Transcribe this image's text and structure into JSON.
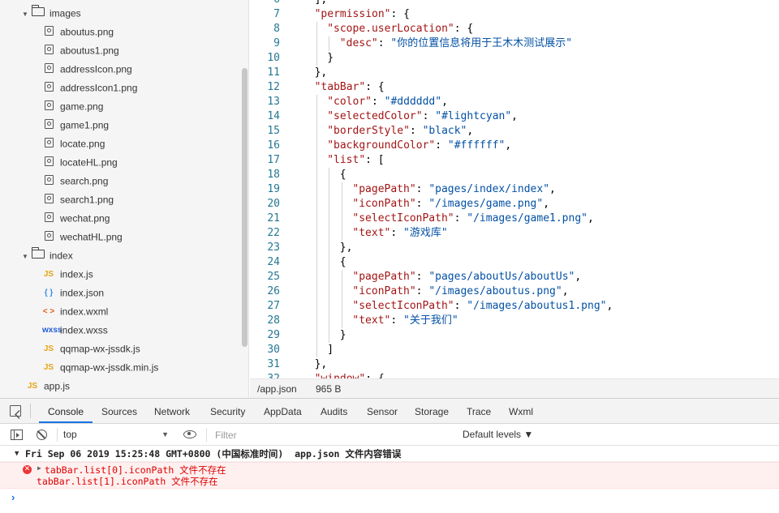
{
  "tree": {
    "rows": [
      {
        "kind": "folder",
        "label": "images",
        "icon": "folder-open-icon",
        "indent": 1
      },
      {
        "kind": "img",
        "label": "aboutus.png",
        "icon": "image-file-icon",
        "indent": 2
      },
      {
        "kind": "img",
        "label": "aboutus1.png",
        "icon": "image-file-icon",
        "indent": 2
      },
      {
        "kind": "img",
        "label": "addressIcon.png",
        "icon": "image-file-icon",
        "indent": 2
      },
      {
        "kind": "img",
        "label": "addressIcon1.png",
        "icon": "image-file-icon",
        "indent": 2
      },
      {
        "kind": "img",
        "label": "game.png",
        "icon": "image-file-icon",
        "indent": 2
      },
      {
        "kind": "img",
        "label": "game1.png",
        "icon": "image-file-icon",
        "indent": 2
      },
      {
        "kind": "img",
        "label": "locate.png",
        "icon": "image-file-icon",
        "indent": 2
      },
      {
        "kind": "img",
        "label": "locateHL.png",
        "icon": "image-file-icon",
        "indent": 2
      },
      {
        "kind": "img",
        "label": "search.png",
        "icon": "image-file-icon",
        "indent": 2
      },
      {
        "kind": "img",
        "label": "search1.png",
        "icon": "image-file-icon",
        "indent": 2
      },
      {
        "kind": "img",
        "label": "wechat.png",
        "icon": "image-file-icon",
        "indent": 2
      },
      {
        "kind": "img",
        "label": "wechatHL.png",
        "icon": "image-file-icon",
        "indent": 2
      },
      {
        "kind": "folder",
        "label": "index",
        "icon": "folder-open-icon",
        "indent": 1
      },
      {
        "kind": "js",
        "label": "index.js",
        "icon": "js-file-icon",
        "badge": "JS",
        "indent": 2
      },
      {
        "kind": "json",
        "label": "index.json",
        "icon": "json-file-icon",
        "badge": "{ }",
        "indent": 2
      },
      {
        "kind": "wxml",
        "label": "index.wxml",
        "icon": "wxml-file-icon",
        "badge": "< >",
        "indent": 2
      },
      {
        "kind": "wxss",
        "label": "index.wxss",
        "icon": "wxss-file-icon",
        "badge": "wxss",
        "indent": 2
      },
      {
        "kind": "js",
        "label": "qqmap-wx-jssdk.js",
        "icon": "js-file-icon",
        "badge": "JS",
        "indent": 2
      },
      {
        "kind": "js",
        "label": "qqmap-wx-jssdk.min.js",
        "icon": "js-file-icon",
        "badge": "JS",
        "indent": 2
      },
      {
        "kind": "js",
        "label": "app.js",
        "icon": "js-file-icon",
        "badge": "JS",
        "indent": 1
      }
    ]
  },
  "editor": {
    "lines": [
      {
        "n": "6",
        "indent": 2,
        "tokens": [
          {
            "t": "p",
            "v": "],"
          }
        ]
      },
      {
        "n": "7",
        "indent": 2,
        "tokens": [
          {
            "t": "k",
            "v": "\"permission\""
          },
          {
            "t": "p",
            "v": ": {"
          }
        ]
      },
      {
        "n": "8",
        "indent": 4,
        "tokens": [
          {
            "t": "k",
            "v": "\"scope.userLocation\""
          },
          {
            "t": "p",
            "v": ": {"
          }
        ]
      },
      {
        "n": "9",
        "indent": 6,
        "tokens": [
          {
            "t": "k",
            "v": "\"desc\""
          },
          {
            "t": "p",
            "v": ": "
          },
          {
            "t": "s",
            "v": "\"你的位置信息将用于王木木测试展示\""
          }
        ]
      },
      {
        "n": "10",
        "indent": 4,
        "tokens": [
          {
            "t": "p",
            "v": "}"
          }
        ]
      },
      {
        "n": "11",
        "indent": 2,
        "tokens": [
          {
            "t": "p",
            "v": "},"
          }
        ]
      },
      {
        "n": "12",
        "indent": 2,
        "tokens": [
          {
            "t": "k",
            "v": "\"tabBar\""
          },
          {
            "t": "p",
            "v": ": {"
          }
        ]
      },
      {
        "n": "13",
        "indent": 4,
        "tokens": [
          {
            "t": "k",
            "v": "\"color\""
          },
          {
            "t": "p",
            "v": ": "
          },
          {
            "t": "s",
            "v": "\"#dddddd\""
          },
          {
            "t": "p",
            "v": ","
          }
        ]
      },
      {
        "n": "14",
        "indent": 4,
        "tokens": [
          {
            "t": "k",
            "v": "\"selectedColor\""
          },
          {
            "t": "p",
            "v": ": "
          },
          {
            "t": "s",
            "v": "\"#lightcyan\""
          },
          {
            "t": "p",
            "v": ","
          }
        ]
      },
      {
        "n": "15",
        "indent": 4,
        "tokens": [
          {
            "t": "k",
            "v": "\"borderStyle\""
          },
          {
            "t": "p",
            "v": ": "
          },
          {
            "t": "s",
            "v": "\"black\""
          },
          {
            "t": "p",
            "v": ","
          }
        ]
      },
      {
        "n": "16",
        "indent": 4,
        "tokens": [
          {
            "t": "k",
            "v": "\"backgroundColor\""
          },
          {
            "t": "p",
            "v": ": "
          },
          {
            "t": "s",
            "v": "\"#ffffff\""
          },
          {
            "t": "p",
            "v": ","
          }
        ]
      },
      {
        "n": "17",
        "indent": 4,
        "tokens": [
          {
            "t": "k",
            "v": "\"list\""
          },
          {
            "t": "p",
            "v": ": ["
          }
        ]
      },
      {
        "n": "18",
        "indent": 6,
        "tokens": [
          {
            "t": "p",
            "v": "{"
          }
        ]
      },
      {
        "n": "19",
        "indent": 8,
        "tokens": [
          {
            "t": "k",
            "v": "\"pagePath\""
          },
          {
            "t": "p",
            "v": ": "
          },
          {
            "t": "s",
            "v": "\"pages/index/index\""
          },
          {
            "t": "p",
            "v": ","
          }
        ]
      },
      {
        "n": "20",
        "indent": 8,
        "tokens": [
          {
            "t": "k",
            "v": "\"iconPath\""
          },
          {
            "t": "p",
            "v": ": "
          },
          {
            "t": "s",
            "v": "\"/images/game.png\""
          },
          {
            "t": "p",
            "v": ","
          }
        ]
      },
      {
        "n": "21",
        "indent": 8,
        "tokens": [
          {
            "t": "k",
            "v": "\"selectIconPath\""
          },
          {
            "t": "p",
            "v": ": "
          },
          {
            "t": "s",
            "v": "\"/images/game1.png\""
          },
          {
            "t": "p",
            "v": ","
          }
        ]
      },
      {
        "n": "22",
        "indent": 8,
        "tokens": [
          {
            "t": "k",
            "v": "\"text\""
          },
          {
            "t": "p",
            "v": ": "
          },
          {
            "t": "s",
            "v": "\"游戏库\""
          }
        ]
      },
      {
        "n": "23",
        "indent": 6,
        "tokens": [
          {
            "t": "p",
            "v": "},"
          }
        ]
      },
      {
        "n": "24",
        "indent": 6,
        "tokens": [
          {
            "t": "p",
            "v": "{"
          }
        ]
      },
      {
        "n": "25",
        "indent": 8,
        "tokens": [
          {
            "t": "k",
            "v": "\"pagePath\""
          },
          {
            "t": "p",
            "v": ": "
          },
          {
            "t": "s",
            "v": "\"pages/aboutUs/aboutUs\""
          },
          {
            "t": "p",
            "v": ","
          }
        ]
      },
      {
        "n": "26",
        "indent": 8,
        "tokens": [
          {
            "t": "k",
            "v": "\"iconPath\""
          },
          {
            "t": "p",
            "v": ": "
          },
          {
            "t": "s",
            "v": "\"/images/aboutus.png\""
          },
          {
            "t": "p",
            "v": ","
          }
        ]
      },
      {
        "n": "27",
        "indent": 8,
        "tokens": [
          {
            "t": "k",
            "v": "\"selectIconPath\""
          },
          {
            "t": "p",
            "v": ": "
          },
          {
            "t": "s",
            "v": "\"/images/aboutus1.png\""
          },
          {
            "t": "p",
            "v": ","
          }
        ]
      },
      {
        "n": "28",
        "indent": 8,
        "tokens": [
          {
            "t": "k",
            "v": "\"text\""
          },
          {
            "t": "p",
            "v": ": "
          },
          {
            "t": "s",
            "v": "\"关于我们\""
          }
        ]
      },
      {
        "n": "29",
        "indent": 6,
        "tokens": [
          {
            "t": "p",
            "v": "}"
          }
        ]
      },
      {
        "n": "30",
        "indent": 4,
        "tokens": [
          {
            "t": "p",
            "v": "]"
          }
        ]
      },
      {
        "n": "31",
        "indent": 2,
        "tokens": [
          {
            "t": "p",
            "v": "},"
          }
        ]
      },
      {
        "n": "32",
        "indent": 2,
        "tokens": [
          {
            "t": "k",
            "v": "\"window\""
          },
          {
            "t": "p",
            "v": ": {"
          }
        ]
      }
    ]
  },
  "statusbar": {
    "file": "/app.json",
    "size": "965 B"
  },
  "devtools": {
    "tabs": [
      "Console",
      "Sources",
      "Network",
      "Security",
      "AppData",
      "Audits",
      "Sensor",
      "Storage",
      "Trace",
      "Wxml"
    ],
    "active_tab": "Console",
    "context": "top",
    "filter_placeholder": "Filter",
    "levels": "Default levels ▼",
    "group_header": "Fri Sep 06 2019 15:25:48 GMT+0800 (中国标准时间)  app.json 文件内容错误",
    "error_line1": "tabBar.list[0].iconPath 文件不存在",
    "error_line2": "tabBar.list[1].iconPath 文件不存在",
    "prompt": "›"
  },
  "colors": {
    "accent": "#1a73e8",
    "error": "#dd0000",
    "json_key": "#a31515",
    "json_string": "#0451a5",
    "line_number": "#237893"
  }
}
